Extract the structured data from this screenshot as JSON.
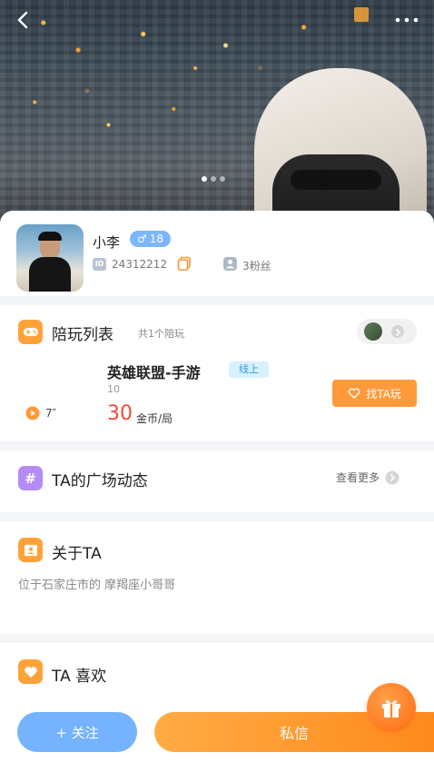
{
  "colors": {
    "accent_orange": "#ff9a3b",
    "blue": "#75b2ff",
    "price_red": "#f24a3f",
    "online_bg": "#d9f0ff",
    "online_text": "#2e9fd8"
  },
  "hero": {
    "carousel": {
      "count": 3,
      "active_index": 0
    }
  },
  "nav": {
    "back_icon": "chevron-left-icon",
    "more_icon": "more-dots-icon"
  },
  "profile": {
    "nickname": "小李",
    "gender_symbol": "♂",
    "age": "18",
    "id_label": "ID",
    "user_id": "24312212",
    "fans": "3粉丝"
  },
  "companion": {
    "title": "陪玩列表",
    "subtitle": "共1个陪玩",
    "game": {
      "name": "英雄联盟-手游",
      "status": "线上",
      "level": "10",
      "duration": "7″",
      "price": "30",
      "price_unit": "金币/局",
      "action_label": "找TA玩"
    }
  },
  "square": {
    "title": "TA的广场动态",
    "more_label": "查看更多"
  },
  "about": {
    "title": "关于TA",
    "text": "位于石家庄市的 摩羯座小哥哥"
  },
  "likes": {
    "title": "TA 喜欢"
  },
  "bottom": {
    "follow_label": "+ 关注",
    "message_label": "私信"
  }
}
